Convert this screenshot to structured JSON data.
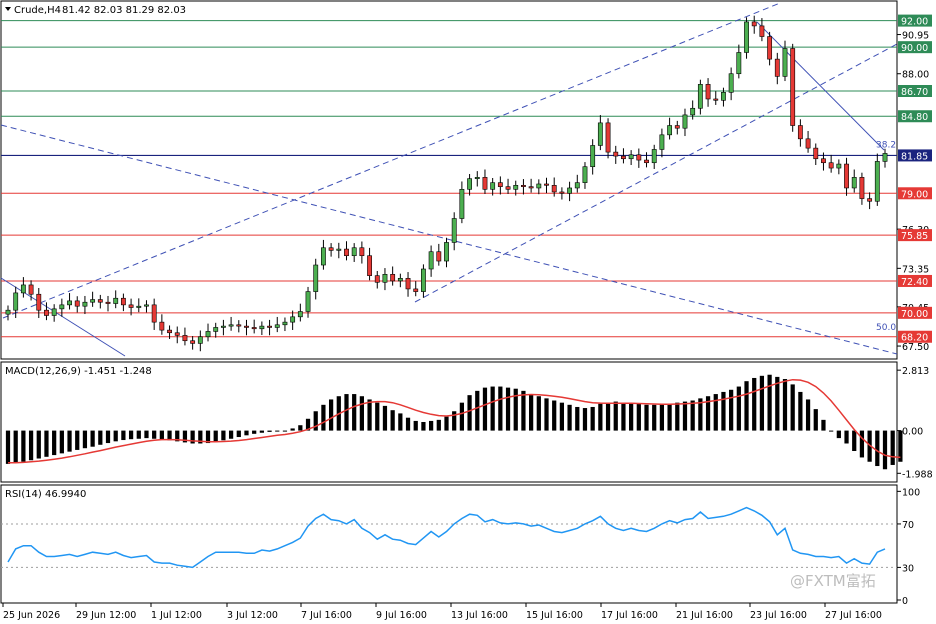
{
  "header": {
    "symbol": "Crude,H4",
    "ohlc": "81.42 82.03 81.29 82.03"
  },
  "watermark": "@FXTM富拓",
  "colors": {
    "bull": "#4caf50",
    "bear": "#e53935",
    "resistance": "#2e8b57",
    "support": "#e53935",
    "current": "#1a237e",
    "channel": "#3f51b5",
    "macd_signal": "#e53935",
    "rsi": "#2196f3"
  },
  "chart_data": [
    {
      "type": "candlestick",
      "ylim": [
        66.6,
        93.4
      ],
      "y_ticks": [
        "90.95",
        "88.00",
        "76.30",
        "73.35",
        "70.45",
        "67.50"
      ],
      "x_ticks": [
        "25 Jun 2026",
        "29 Jun 12:00",
        "1 Jul 12:00",
        "3 Jul 12:00",
        "7 Jul 16:00",
        "9 Jul 16:00",
        "13 Jul 16:00",
        "15 Jul 16:00",
        "17 Jul 16:00",
        "21 Jul 16:00",
        "23 Jul 16:00",
        "27 Jul 16:00"
      ],
      "close": [
        70.2,
        71.5,
        72.1,
        71.4,
        70.2,
        69.8,
        70.3,
        70.6,
        70.9,
        70.5,
        70.8,
        71.0,
        70.8,
        70.7,
        71.1,
        70.6,
        70.4,
        70.5,
        70.6,
        69.3,
        68.7,
        68.5,
        68.3,
        67.9,
        67.7,
        68.2,
        68.6,
        68.9,
        69.0,
        69.1,
        69.0,
        68.9,
        68.8,
        69.0,
        68.9,
        69.1,
        69.3,
        69.7,
        70.1,
        71.6,
        73.6,
        74.9,
        74.7,
        74.8,
        74.3,
        74.9,
        74.3,
        72.8,
        72.3,
        72.9,
        72.4,
        72.6,
        71.8,
        71.6,
        73.3,
        74.6,
        73.9,
        75.3,
        77.1,
        79.3,
        80.1,
        80.2,
        79.3,
        79.8,
        79.5,
        79.3,
        79.6,
        79.5,
        79.4,
        79.7,
        79.6,
        79.1,
        79.0,
        79.4,
        79.8,
        81.0,
        82.6,
        84.3,
        82.1,
        81.8,
        81.6,
        81.9,
        81.5,
        81.3,
        82.3,
        83.4,
        84.1,
        83.9,
        84.9,
        85.4,
        87.2,
        86.1,
        86.0,
        86.6,
        88.0,
        89.6,
        91.9,
        91.6,
        90.8,
        89.1,
        87.8,
        89.9,
        84.1,
        83.1,
        82.4,
        81.6,
        81.3,
        80.9,
        81.2,
        79.4,
        80.2,
        78.6,
        78.4,
        81.4,
        82.0
      ],
      "price_levels": [
        {
          "value": 92.0,
          "label": "92.00",
          "kind": "resistance"
        },
        {
          "value": 90.0,
          "label": "90.00",
          "kind": "resistance"
        },
        {
          "value": 86.7,
          "label": "86.70",
          "kind": "resistance"
        },
        {
          "value": 84.8,
          "label": "84.80",
          "kind": "resistance"
        },
        {
          "value": 81.85,
          "label": "81.85",
          "kind": "current"
        },
        {
          "value": 79.0,
          "label": "79.00",
          "kind": "support"
        },
        {
          "value": 75.85,
          "label": "75.85",
          "kind": "support"
        },
        {
          "value": 72.4,
          "label": "72.40",
          "kind": "support"
        },
        {
          "value": 70.0,
          "label": "70.00",
          "kind": "support"
        },
        {
          "value": 68.2,
          "label": "68.20",
          "kind": "support"
        }
      ],
      "fib_labels": [
        {
          "text": "38.2",
          "value": 82.3
        },
        {
          "text": "50.0",
          "value": 68.55
        }
      ]
    },
    {
      "type": "bar",
      "title": "MACD(12,26,9) -1.451 -1.248",
      "ylim": [
        -2.3,
        3.1
      ],
      "y_ticks": [
        "2.813",
        "0.00",
        "-1.988"
      ],
      "values": [
        -1.55,
        -1.5,
        -1.45,
        -1.38,
        -1.3,
        -1.22,
        -1.14,
        -1.06,
        -0.98,
        -0.9,
        -0.82,
        -0.75,
        -0.66,
        -0.58,
        -0.5,
        -0.44,
        -0.4,
        -0.38,
        -0.35,
        -0.38,
        -0.4,
        -0.45,
        -0.5,
        -0.55,
        -0.6,
        -0.6,
        -0.58,
        -0.52,
        -0.45,
        -0.38,
        -0.3,
        -0.22,
        -0.15,
        -0.1,
        -0.06,
        -0.04,
        0.0,
        0.1,
        0.25,
        0.55,
        0.9,
        1.2,
        1.45,
        1.6,
        1.7,
        1.7,
        1.6,
        1.45,
        1.3,
        1.15,
        0.95,
        0.8,
        0.6,
        0.45,
        0.4,
        0.45,
        0.5,
        0.65,
        0.9,
        1.3,
        1.65,
        1.85,
        2.0,
        2.05,
        2.05,
        2.0,
        1.95,
        1.85,
        1.7,
        1.6,
        1.5,
        1.4,
        1.3,
        1.2,
        1.1,
        1.05,
        1.1,
        1.25,
        1.3,
        1.35,
        1.3,
        1.28,
        1.25,
        1.2,
        1.2,
        1.22,
        1.25,
        1.3,
        1.35,
        1.4,
        1.5,
        1.6,
        1.7,
        1.8,
        1.9,
        2.05,
        2.3,
        2.45,
        2.55,
        2.6,
        2.5,
        2.4,
        2.15,
        1.8,
        1.45,
        1.0,
        0.5,
        0.0,
        -0.35,
        -0.6,
        -0.95,
        -1.25,
        -1.45,
        -1.65,
        -1.8,
        -1.6,
        -1.451
      ],
      "signal": [
        -1.5,
        -1.5,
        -1.48,
        -1.45,
        -1.42,
        -1.38,
        -1.33,
        -1.28,
        -1.22,
        -1.15,
        -1.08,
        -1.0,
        -0.93,
        -0.85,
        -0.77,
        -0.7,
        -0.63,
        -0.56,
        -0.5,
        -0.45,
        -0.42,
        -0.42,
        -0.43,
        -0.45,
        -0.48,
        -0.5,
        -0.52,
        -0.52,
        -0.51,
        -0.49,
        -0.46,
        -0.42,
        -0.37,
        -0.32,
        -0.27,
        -0.22,
        -0.18,
        -0.12,
        -0.05,
        0.06,
        0.2,
        0.38,
        0.58,
        0.78,
        0.96,
        1.12,
        1.24,
        1.32,
        1.35,
        1.35,
        1.3,
        1.2,
        1.08,
        0.95,
        0.84,
        0.76,
        0.7,
        0.68,
        0.72,
        0.8,
        0.92,
        1.06,
        1.2,
        1.34,
        1.46,
        1.55,
        1.62,
        1.66,
        1.68,
        1.67,
        1.64,
        1.6,
        1.55,
        1.49,
        1.42,
        1.35,
        1.3,
        1.28,
        1.27,
        1.27,
        1.27,
        1.27,
        1.26,
        1.25,
        1.24,
        1.23,
        1.23,
        1.24,
        1.25,
        1.27,
        1.3,
        1.35,
        1.4,
        1.46,
        1.53,
        1.6,
        1.7,
        1.82,
        1.95,
        2.08,
        2.2,
        2.3,
        2.37,
        2.35,
        2.25,
        2.05,
        1.75,
        1.38,
        0.95,
        0.5,
        0.05,
        -0.35,
        -0.68,
        -0.95,
        -1.15,
        -1.22,
        -1.248
      ]
    },
    {
      "type": "line",
      "title": "RSI(14) 46.9940",
      "ylim": [
        0,
        104
      ],
      "y_ticks": [
        "100",
        "70",
        "30",
        "0"
      ],
      "levels": [
        70,
        30
      ],
      "values": [
        35,
        47,
        50,
        50,
        44,
        40,
        40,
        41,
        42,
        40,
        42,
        44,
        43,
        42,
        44,
        41,
        39,
        40,
        41,
        35,
        34,
        34,
        32,
        31,
        30,
        35,
        40,
        44,
        44,
        44,
        44,
        43,
        43,
        46,
        45,
        47,
        50,
        53,
        57,
        68,
        75,
        79,
        74,
        73,
        70,
        74,
        66,
        62,
        56,
        60,
        56,
        55,
        52,
        51,
        57,
        63,
        58,
        63,
        70,
        75,
        79,
        78,
        72,
        74,
        71,
        70,
        71,
        70,
        68,
        69,
        66,
        63,
        62,
        64,
        66,
        70,
        73,
        77,
        70,
        66,
        64,
        66,
        64,
        63,
        66,
        70,
        73,
        71,
        74,
        75,
        81,
        75,
        76,
        77,
        79,
        82,
        85,
        82,
        78,
        72,
        60,
        66,
        46,
        43,
        42,
        40,
        40,
        39,
        40,
        34,
        38,
        34,
        33,
        44,
        47
      ]
    }
  ]
}
